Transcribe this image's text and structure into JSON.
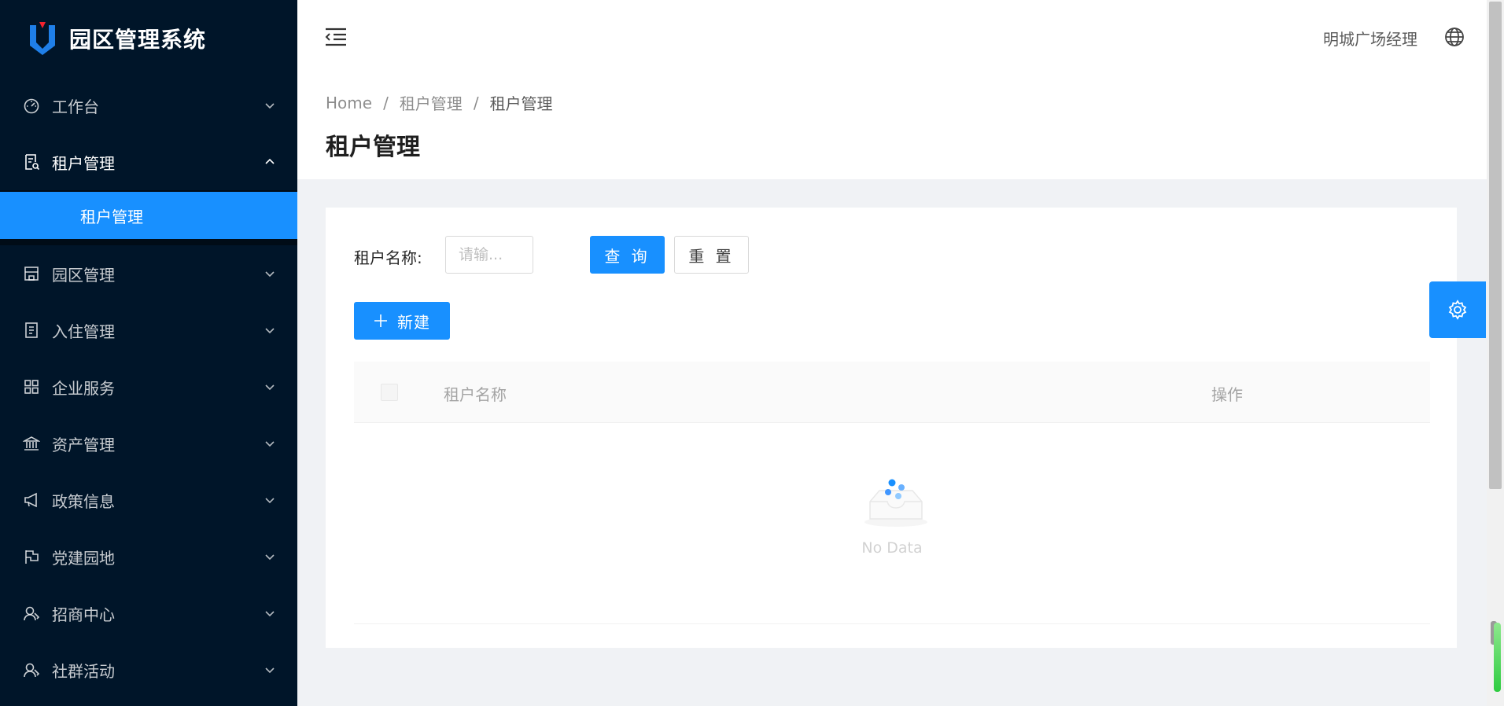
{
  "app": {
    "title": "园区管理系统"
  },
  "sidebar": {
    "items": [
      {
        "label": "工作台",
        "icon": "dashboard-icon"
      },
      {
        "label": "租户管理",
        "icon": "file-search-icon",
        "open": true
      },
      {
        "label": "园区管理",
        "icon": "building-icon"
      },
      {
        "label": "入住管理",
        "icon": "document-icon"
      },
      {
        "label": "企业服务",
        "icon": "appstore-icon"
      },
      {
        "label": "资产管理",
        "icon": "bank-icon"
      },
      {
        "label": "政策信息",
        "icon": "megaphone-icon"
      },
      {
        "label": "党建园地",
        "icon": "flag-icon"
      },
      {
        "label": "招商中心",
        "icon": "team-icon"
      },
      {
        "label": "社群活动",
        "icon": "team-icon"
      }
    ],
    "subitems": [
      {
        "label": "租户管理",
        "active": true
      }
    ]
  },
  "header": {
    "user_name": "明城广场经理",
    "language_icon": "globe-icon",
    "fold_icon": "menu-fold-icon"
  },
  "breadcrumb": [
    "Home",
    "租户管理",
    "租户管理"
  ],
  "page": {
    "title": "租户管理"
  },
  "search": {
    "label": "租户名称:",
    "placeholder": "请输...",
    "value": "",
    "query_label": "查 询",
    "reset_label": "重 置"
  },
  "toolbar": {
    "new_label": "新建"
  },
  "table": {
    "columns": [
      "租户名称",
      "操作"
    ],
    "rows": [],
    "empty_text": "No Data"
  },
  "colors": {
    "primary": "#1890ff",
    "sidebar_bg": "#001529",
    "page_bg": "#f0f2f5"
  }
}
